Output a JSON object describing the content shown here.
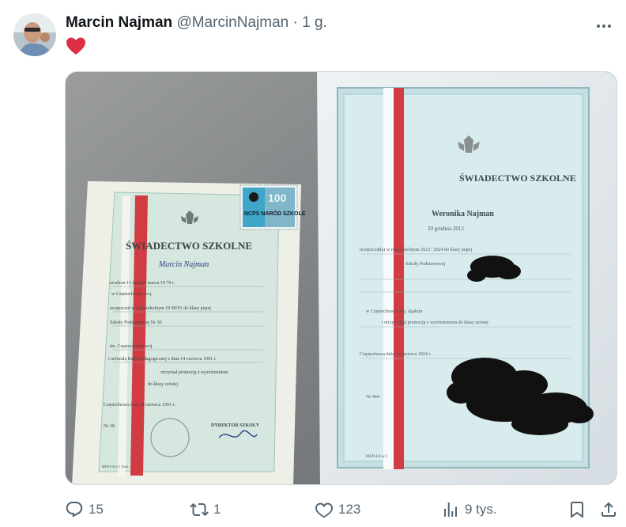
{
  "post": {
    "author_name": "Marcin Najman",
    "author_handle": "@MarcinNajman",
    "separator": "·",
    "time": "1 g.",
    "text_icon": "red-heart-emoji"
  },
  "media": {
    "left_certificate": {
      "title": "ŚWIADECTWO SZKOLNE",
      "stamp": "NCPS NARÓD SZKOLE",
      "stamp_value": "100",
      "name": "Marcin Najman",
      "line_born": "urodzon 11 dnia 13 marca 19 79 r.",
      "line_place": "w Częstochowie woj.",
      "line_year": "uczęszczał w roku szkolnym 19 90/91 do klasy piątej",
      "line_school": "Szkoły Podstawowej Nr 30",
      "line_city": "im. Częstochowie woj.",
      "line_resolution": "i uchwałą Rady Pedagogicznej z dnia 14 czerwca 1991 r.",
      "line_promo": "otrzymał promocję z wyróżnieniem",
      "line_class": "do klasy szóstej",
      "line_date": "Częstochowa dnia 14 czerwca 1991 r.",
      "line_nr": "Nr 18",
      "director": "DYREKTOR SZKOŁY",
      "footer": "MEN-I/54/2, 1  Druk ..."
    },
    "right_certificate": {
      "title": "ŚWIADECTWO SZKOLNE",
      "name": "Weronika Najman",
      "date": "20 grudnia 2012",
      "line_year": "uczęszczał(a) w roku szkolnym 2023 / 2024 do klasy piątej",
      "line_school": "Szkoły Podstawowej",
      "line_city": "w Częstochowie woj. śląskim",
      "line_promo": "i otrzymał(a) promocję z wyróżnieniem do klasy szóstej",
      "line_date": "Częstochowa dnia 21 czerwca 2024 r.",
      "line_nr": "Nr 464",
      "footer": "MEN-I/4-w/1"
    }
  },
  "actions": {
    "replies": "15",
    "reposts": "1",
    "likes": "123",
    "views": "9 tys."
  },
  "colors": {
    "text_secondary": "#536471",
    "heart": "#f91880",
    "border": "#cfd9de"
  }
}
